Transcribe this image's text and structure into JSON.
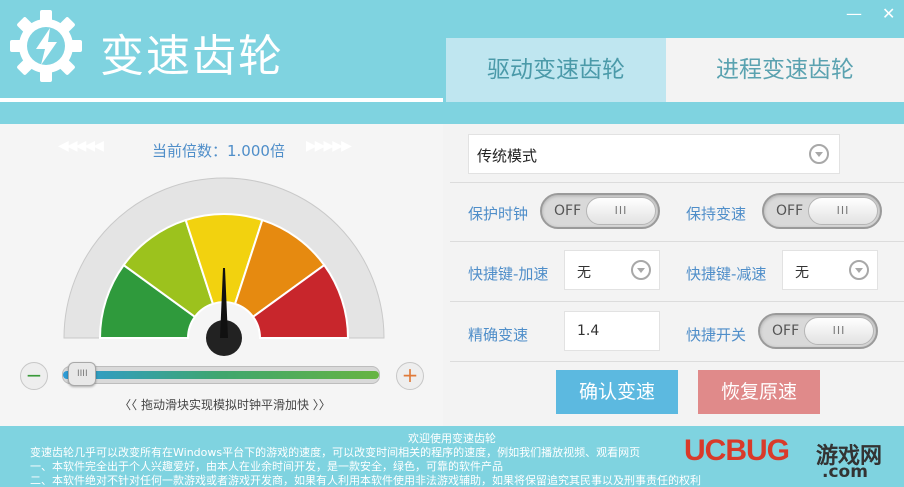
{
  "window": {
    "title": "变速齿轮",
    "minimize": "—",
    "close": "✕"
  },
  "tabs": [
    "驱动变速齿轮",
    "进程变速齿轮"
  ],
  "speed": {
    "left_arrows": "◀◀◀◀◀",
    "right_arrows": "▶▶▶▶▶",
    "multiplier_label": "当前倍数：1.000倍",
    "multiplier": 1.0,
    "slider_level": 0.02,
    "slider_handle": "IIII",
    "minus": "−",
    "plus": "+",
    "hint": "〈〈 拖动滑块实现模拟时钟平滑加快 〉〉"
  },
  "settings": {
    "mode": "传统模式",
    "protect_clock_label": "保护时钟",
    "keep_speed_label": "保持变速",
    "hotkey_up_label": "快捷键-加速",
    "hotkey_up_value": "无",
    "hotkey_down_label": "快捷键-减速",
    "hotkey_down_value": "无",
    "precise_label": "精确变速",
    "precise_value": "1.4",
    "hotkey_switch_label": "快捷开关",
    "toggle_off": "OFF",
    "toggle_grip": "III"
  },
  "buttons": {
    "confirm": "确认变速",
    "restore": "恢复原速"
  },
  "notice": {
    "title": "欢迎使用变速齿轮",
    "line1": "变速齿轮几乎可以改变所有在Windows平台下的游戏的速度，可以改变时间相关的程序的速度，例如我们播放视频、观看网页",
    "line2": "一、本软件完全出于个人兴趣爱好，由本人在业余时间开发，是一款安全，绿色，可靠的软件产品",
    "line3": "二、本软件绝对不针对任何一款游戏或者游戏开发商，如果有人利用本软件使用非法游戏辅助，如果将保留追究其民事以及刑事责任的权利"
  },
  "watermark": {
    "brand": "UCBUG",
    "site": "游戏网",
    "domain": ".com"
  },
  "colors": {
    "accent": "#7fd3e0",
    "label_blue": "#4f8ec9",
    "confirm": "#5cb9e0",
    "restore": "#e08a8a",
    "gauge": [
      "#2f9a3c",
      "#9cc21d",
      "#f2d20f",
      "#e68a10",
      "#c8262c"
    ]
  }
}
